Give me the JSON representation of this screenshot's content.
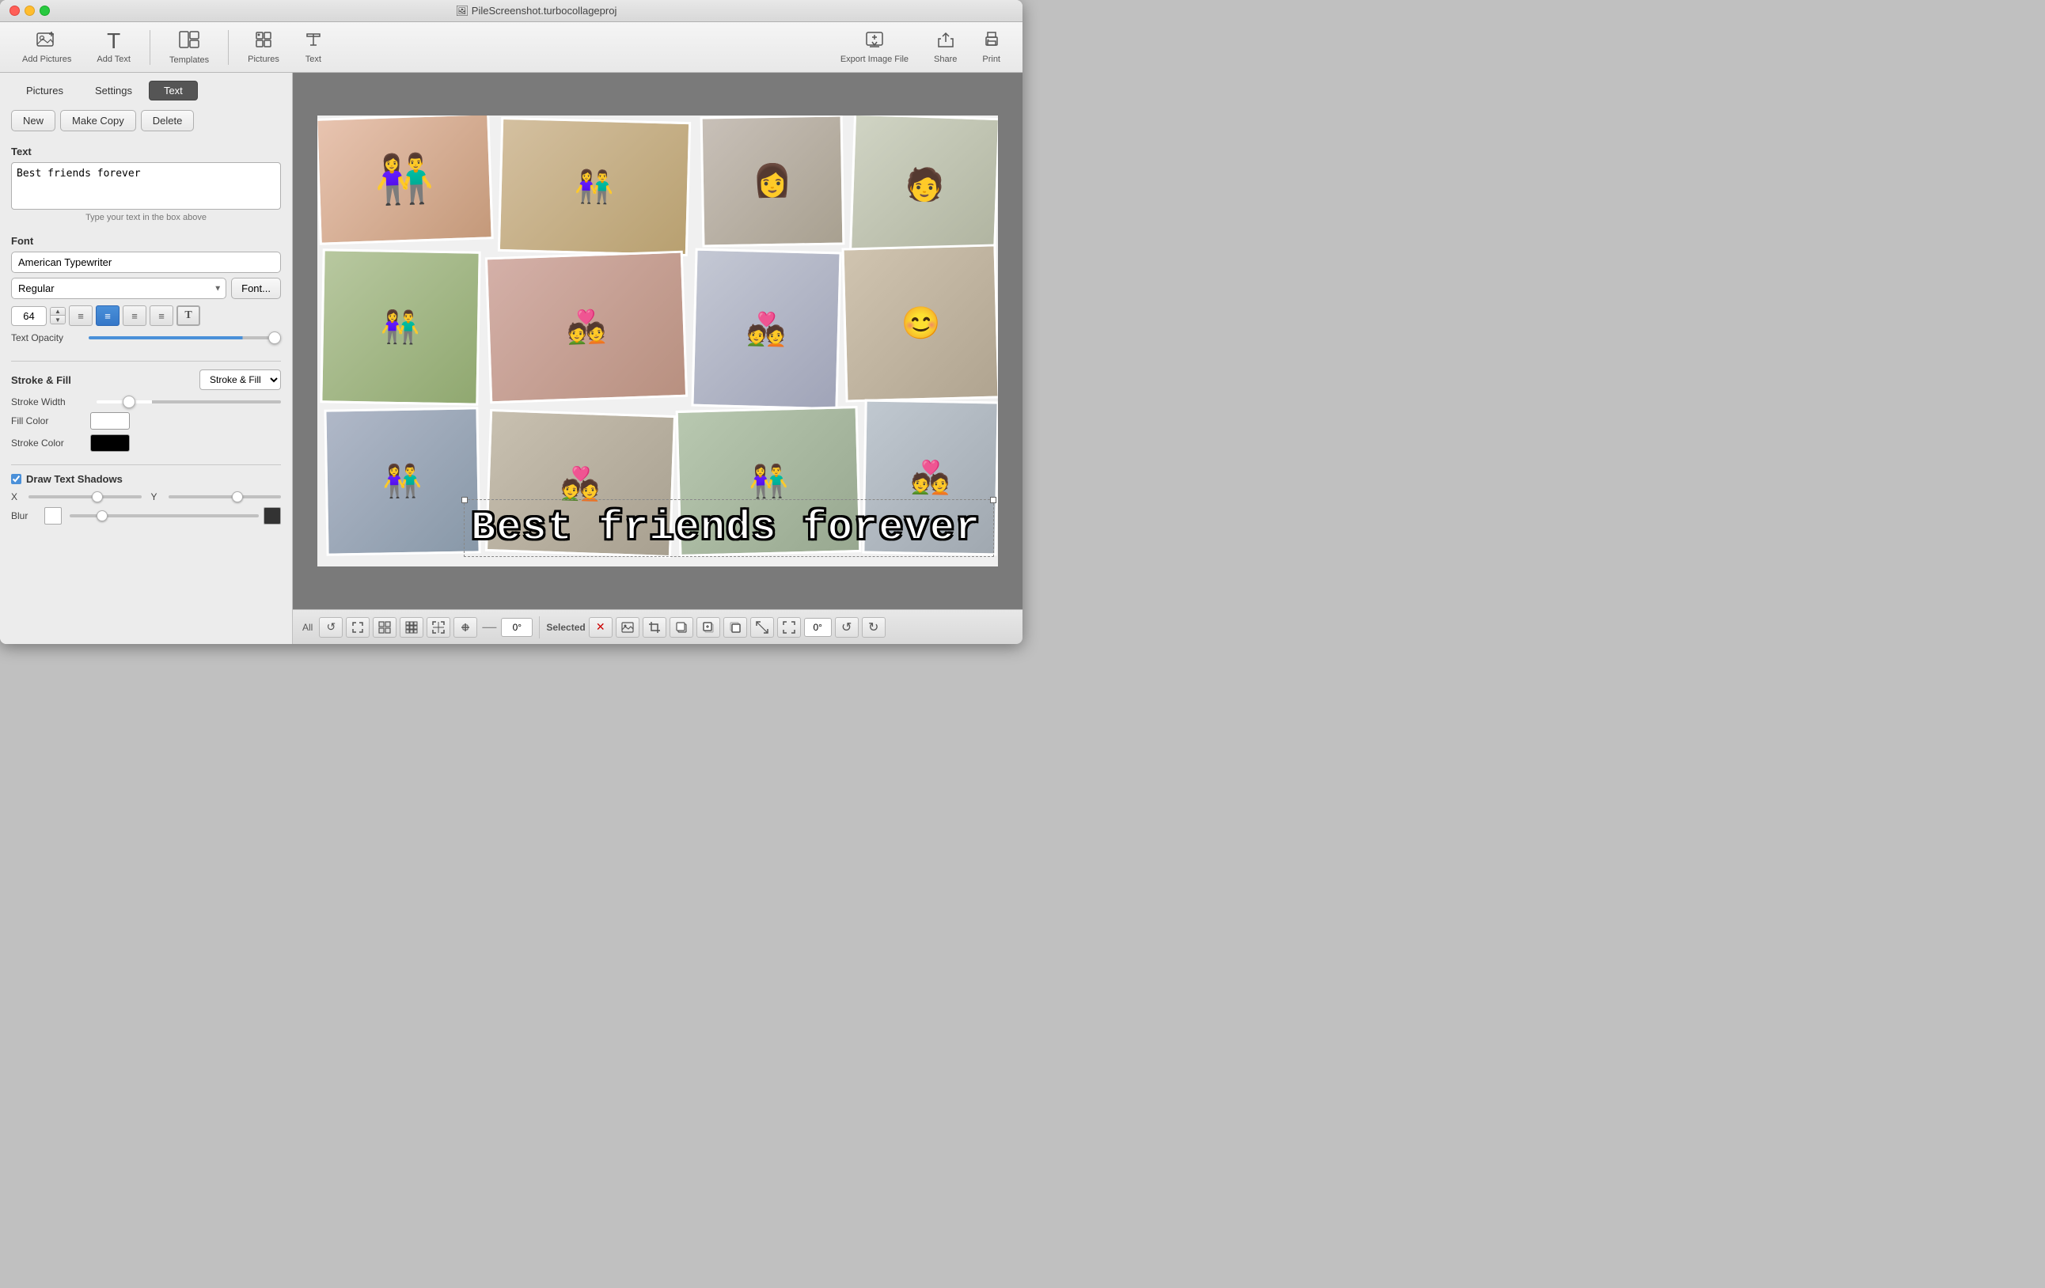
{
  "window": {
    "title": "🖼 PileScreenshot.turbocollageproj"
  },
  "traffic_lights": {
    "close": "close",
    "minimize": "minimize",
    "maximize": "maximize"
  },
  "toolbar": {
    "add_pictures_label": "Add Pictures",
    "add_text_label": "Add Text",
    "templates_label": "Templates",
    "pictures_label": "Pictures",
    "text_label": "Text",
    "export_label": "Export Image File",
    "share_label": "Share",
    "print_label": "Print"
  },
  "tabs": {
    "pictures": "Pictures",
    "settings": "Settings",
    "text": "Text"
  },
  "sidebar": {
    "new_btn": "New",
    "make_copy_btn": "Make Copy",
    "delete_btn": "Delete",
    "text_section": "Text",
    "text_value": "Best friends forever",
    "text_hint": "Type your text in the box above",
    "font_section": "Font",
    "font_name": "American Typewriter",
    "font_style": "Regular",
    "font_btn": "Font...",
    "font_size": "64",
    "opacity_label": "Text Opacity",
    "stroke_fill_section": "Stroke & Fill",
    "stroke_fill_option": "Stroke & Fill",
    "stroke_width_label": "Stroke Width",
    "fill_color_label": "Fill Color",
    "stroke_color_label": "Stroke Color",
    "draw_shadows_label": "Draw Text Shadows",
    "x_label": "X",
    "y_label": "Y",
    "blur_label": "Blur"
  },
  "canvas": {
    "text_overlay": "Best friends forever"
  },
  "bottom_bar": {
    "all_label": "All",
    "selected_label": "Selected",
    "rotate_value": "0°"
  }
}
